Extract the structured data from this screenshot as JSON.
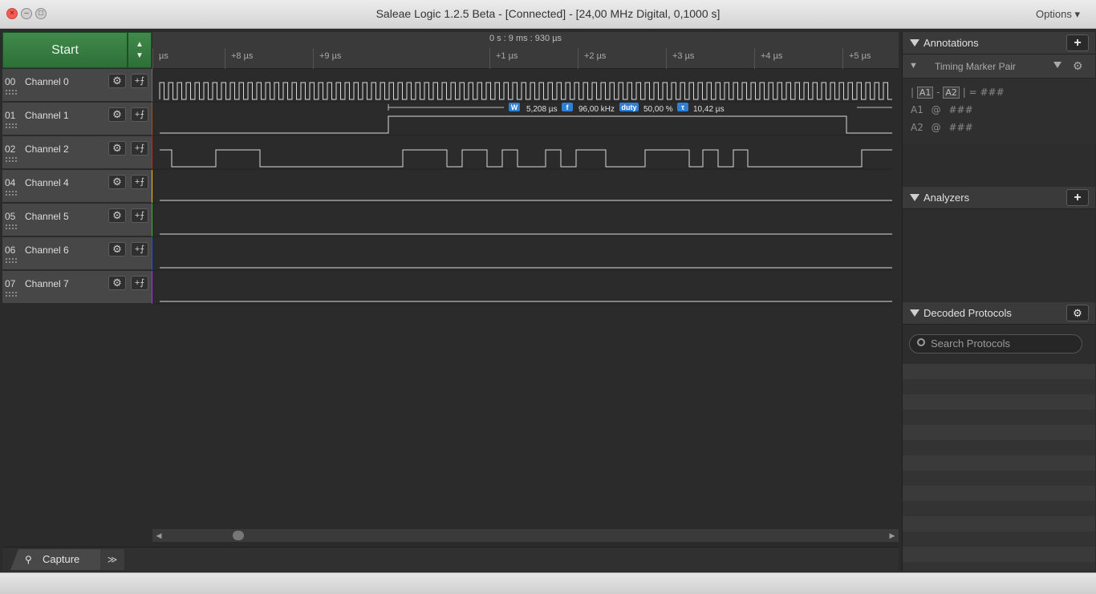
{
  "window": {
    "title": "Saleae Logic 1.2.5 Beta - [Connected] - [24,00 MHz Digital, 0,1000 s]",
    "options_label": "Options ▾"
  },
  "start_button": {
    "label": "Start",
    "updown": "▲\n▼"
  },
  "channels": [
    {
      "num": "00",
      "name": "Channel 0",
      "color": "#6b6b6b"
    },
    {
      "num": "01",
      "name": "Channel 1",
      "color": "#8a5a2b"
    },
    {
      "num": "02",
      "name": "Channel 2",
      "color": "#c0282c"
    },
    {
      "num": "04",
      "name": "Channel 4",
      "color": "#e8c21a"
    },
    {
      "num": "05",
      "name": "Channel 5",
      "color": "#4aa83a"
    },
    {
      "num": "06",
      "name": "Channel 6",
      "color": "#2f4fd0"
    },
    {
      "num": "07",
      "name": "Channel 7",
      "color": "#9a3fc7"
    }
  ],
  "channel_icons": {
    "gear": "gear-icon",
    "trigger": "trigger-icon"
  },
  "timeline": {
    "reference": "0 s : 9 ms : 930 µs",
    "ticks": [
      "µs",
      "+8 µs",
      "+9 µs",
      "+1 µs",
      "+2 µs",
      "+3 µs",
      "+4 µs",
      "+5 µs"
    ]
  },
  "measurement": {
    "width_tag": "W",
    "width": "5,208 µs",
    "freq_tag": "f",
    "freq": "96,00 kHz",
    "duty_tag": "duty",
    "duty": "50,00 %",
    "period_tag": "τ",
    "period": "10,42 µs"
  },
  "bottom": {
    "capture_tab": "Capture",
    "expand": "≫"
  },
  "annotations": {
    "title": "Annotations",
    "marker_pair": "Timing Marker Pair",
    "line1_a1": "A1",
    "line1_sep": "-",
    "line1_a2": "A2",
    "line1_eq": "= ###",
    "line2_label": "A1",
    "line2_at": "@",
    "line2_val": "###",
    "line3_label": "A2",
    "line3_at": "@",
    "line3_val": "###"
  },
  "analyzers": {
    "title": "Analyzers"
  },
  "decoded_protocols": {
    "title": "Decoded Protocols",
    "search_placeholder": "Search Protocols"
  }
}
